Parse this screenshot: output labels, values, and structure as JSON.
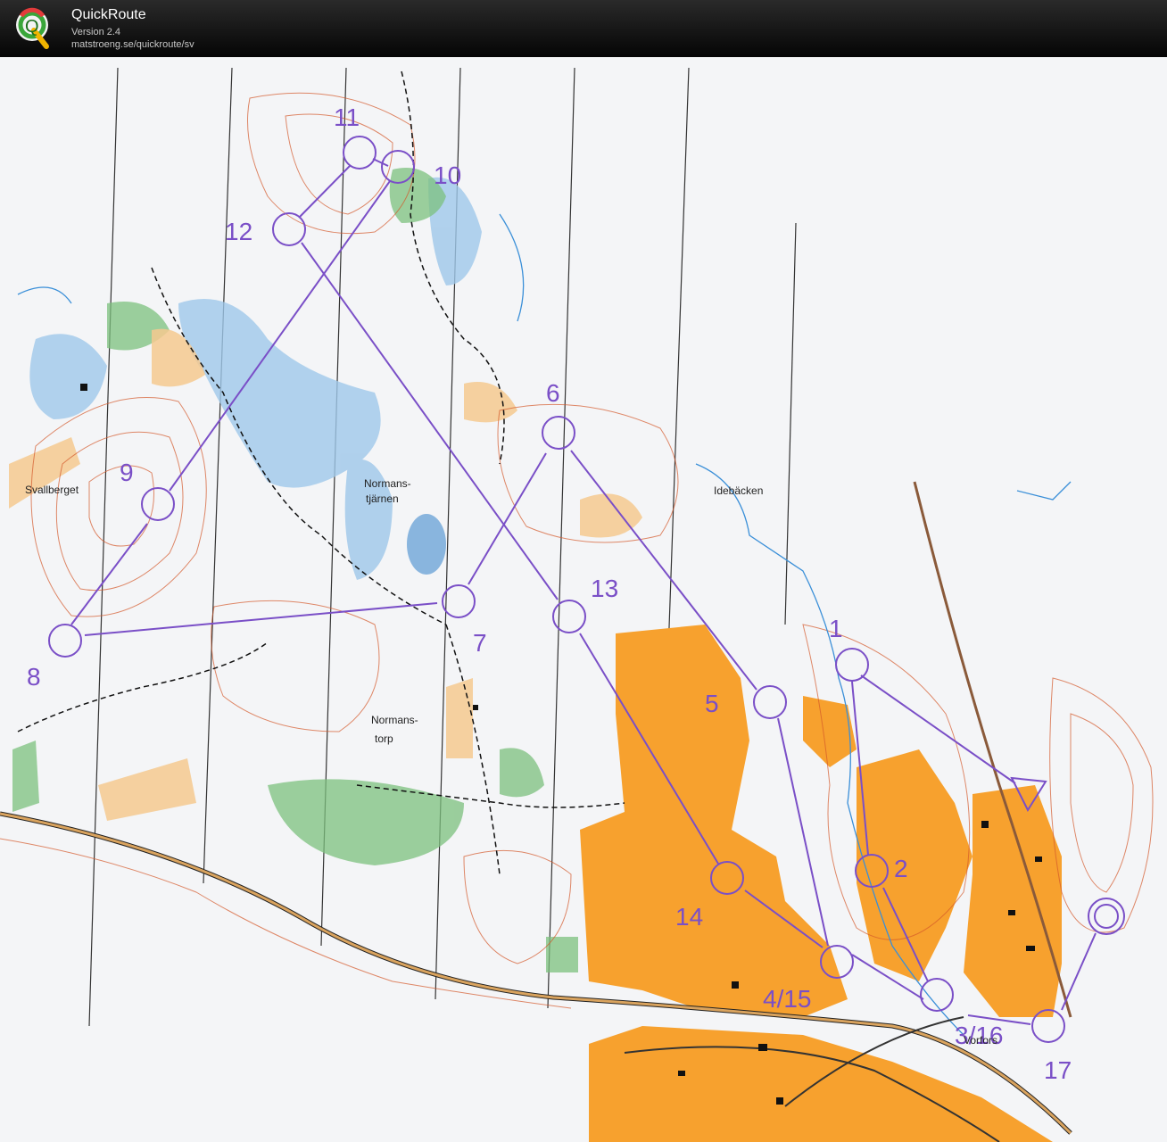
{
  "app": {
    "title": "QuickRoute",
    "version": "Version 2.4",
    "url": "matstroeng.se/quickroute/sv",
    "logo_letter": "Q"
  },
  "colors": {
    "course": "#7a4fc7",
    "urban": "#f5a02a",
    "open": "#f4c98a",
    "forest_green": "#5fb36b",
    "water": "#8fbfe6",
    "contour": "#d65a2a",
    "paper": "#f4f5f7"
  },
  "map": {
    "place_names": {
      "svallberget": "Svallberget",
      "normanstjarnen": "Normans-\ntjärnen",
      "idebacken": "Idebäcken",
      "normanstorp": "Normans-\ntorp",
      "vorforo": "Vorfors"
    },
    "controls": [
      {
        "id": "1",
        "label": "1"
      },
      {
        "id": "2",
        "label": "2"
      },
      {
        "id": "3/16",
        "label": "3/16"
      },
      {
        "id": "4/15",
        "label": "4/15"
      },
      {
        "id": "5",
        "label": "5"
      },
      {
        "id": "6",
        "label": "6"
      },
      {
        "id": "7",
        "label": "7"
      },
      {
        "id": "8",
        "label": "8"
      },
      {
        "id": "9",
        "label": "9"
      },
      {
        "id": "10",
        "label": "10"
      },
      {
        "id": "11",
        "label": "11"
      },
      {
        "id": "12",
        "label": "12"
      },
      {
        "id": "13",
        "label": "13"
      },
      {
        "id": "14",
        "label": "14"
      },
      {
        "id": "17",
        "label": "17"
      }
    ]
  }
}
